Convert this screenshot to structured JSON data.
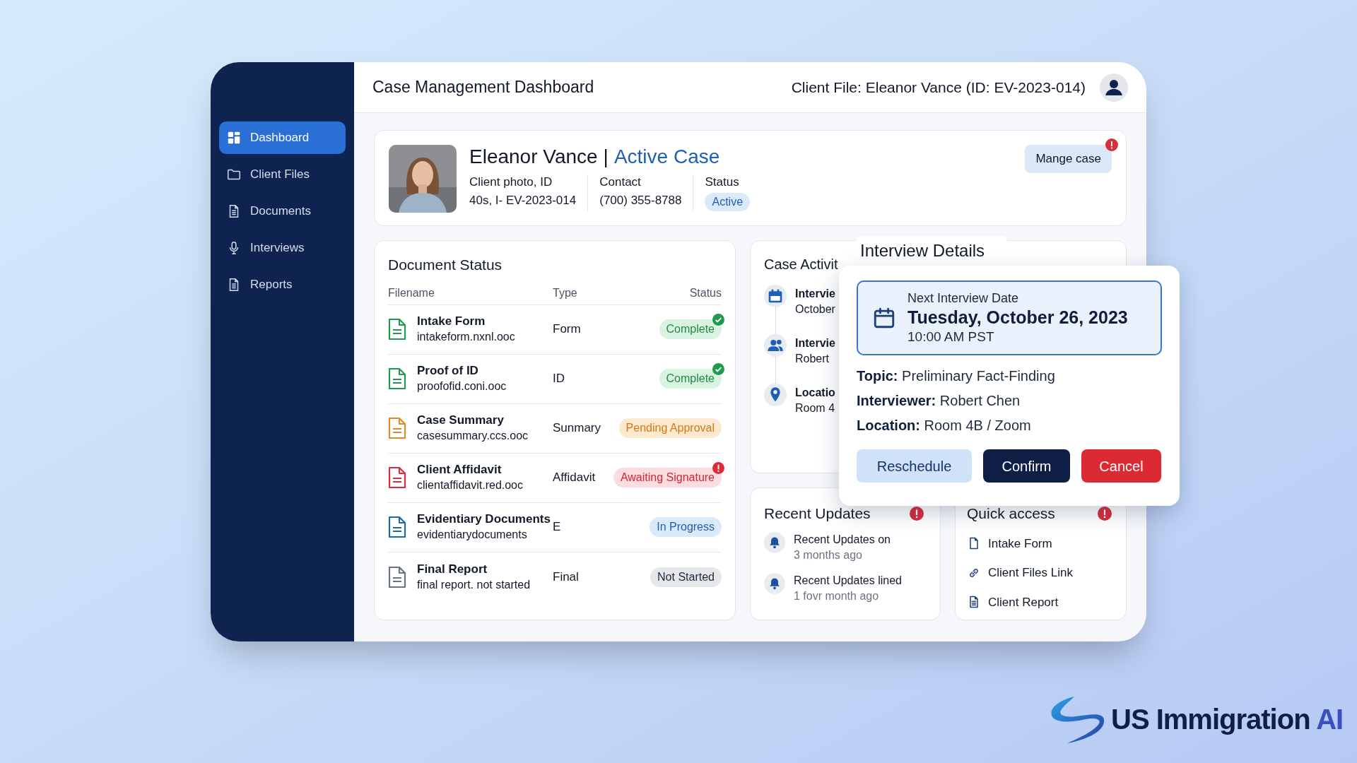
{
  "sidebar": {
    "items": [
      {
        "label": "Dashboard",
        "selected": true
      },
      {
        "label": "Client Files",
        "selected": false
      },
      {
        "label": "Documents",
        "selected": false
      },
      {
        "label": "Interviews",
        "selected": false
      },
      {
        "label": "Reports",
        "selected": false
      }
    ]
  },
  "header": {
    "title": "Case Management Dashboard",
    "client_file": "Client File: Eleanor Vance (ID: EV-2023-014)"
  },
  "profile": {
    "name": "Eleanor Vance",
    "separator": "|",
    "case_label": "Active Case",
    "fields": [
      {
        "label": "Client photo, ID",
        "value": "40s, I- EV-2023-014",
        "kind": "text"
      },
      {
        "label": "Contact",
        "value": "(700) 355-8788",
        "kind": "text"
      },
      {
        "label": "Status",
        "value": "Active",
        "kind": "badge"
      }
    ],
    "button": "Mange case",
    "alert": true
  },
  "documents": {
    "title": "Document Status",
    "columns": [
      "Filename",
      "Type",
      "Status"
    ],
    "rows": [
      {
        "name": "Intake Form",
        "file": "intakeform.nxnl.ooc",
        "type": "Form",
        "status": "Complete",
        "kind": "complete",
        "verified": true,
        "alert": false
      },
      {
        "name": "Proof of ID",
        "file": "proofofid.coni.ooc",
        "type": "ID",
        "status": "Complete",
        "kind": "complete",
        "verified": true,
        "alert": false
      },
      {
        "name": "Case Summary",
        "file": "casesummary.ccs.ooc",
        "type": "Sunmary",
        "status": "Pending Approval",
        "kind": "pending",
        "verified": false,
        "alert": false
      },
      {
        "name": "Client Affidavit",
        "file": "clientaffidavit.red.ooc",
        "type": "Affidavit",
        "status": "Awaiting Signature",
        "kind": "awaiting",
        "verified": false,
        "alert": true
      },
      {
        "name": "Evidentiary Documents",
        "file": "evidentiarydocuments",
        "type": "E",
        "status": "In Progress",
        "kind": "progress",
        "verified": false,
        "alert": false
      },
      {
        "name": "Final Report",
        "file": "final report. not started",
        "type": "Final",
        "status": "Not Started",
        "kind": "notstarted",
        "verified": false,
        "alert": false
      }
    ]
  },
  "case_activity": {
    "title": "Case Activit",
    "items": [
      {
        "title": "Intervie",
        "detail": "October",
        "kind": "calendar"
      },
      {
        "title": "Intervie",
        "detail": "Robert",
        "kind": "people"
      },
      {
        "title": "Locatio",
        "detail": "Room 4",
        "kind": "location"
      }
    ]
  },
  "interview_details": {
    "title": "Interview Details",
    "date_label": "Next Interview Date",
    "date": "Tuesday, October 26, 2023",
    "time": "10:00 AM PST",
    "lines": [
      "**Topic:** Preliminary Fact-Finding",
      "**Interviewer:** Robert Chen",
      "**Location:** Room 4B / Zoom"
    ],
    "buttons": [
      {
        "label": "Reschedule",
        "kind": "secondary"
      },
      {
        "label": "Confirm",
        "kind": "primary"
      },
      {
        "label": "Cancel",
        "kind": "danger"
      }
    ]
  },
  "recent_updates": {
    "title": "Recent Updates",
    "alert": true,
    "items": [
      {
        "text": "**Recent Updates** on",
        "time": "3 months ago"
      },
      {
        "text": "**Recent Updates** lined",
        "time": "1 fovr month ago"
      }
    ]
  },
  "quick_access": {
    "title": "Quick access",
    "alert": true,
    "items": [
      {
        "label": "Intake Form",
        "kind": "file"
      },
      {
        "label": "Client Files Link",
        "kind": "link"
      },
      {
        "label": "Client Report",
        "kind": "report"
      }
    ]
  },
  "logo": {
    "text": "US Immigration",
    "accent": "AI"
  }
}
